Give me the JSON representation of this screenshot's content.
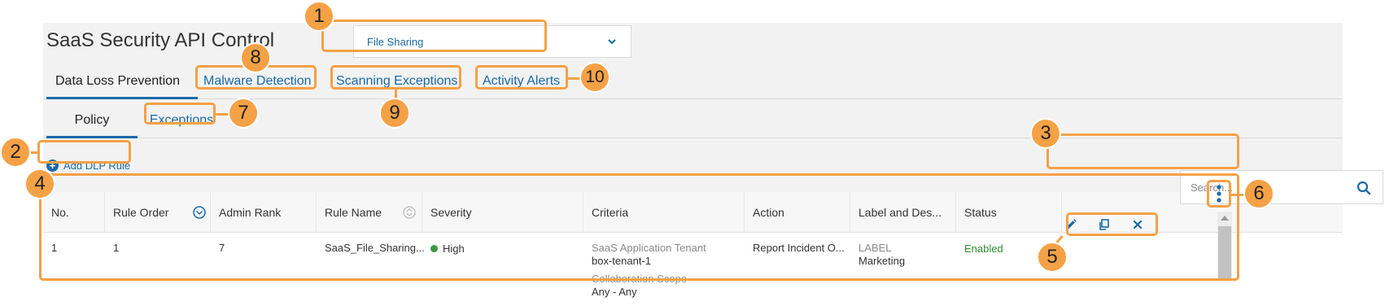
{
  "app": {
    "title": "SaaS Security API Control"
  },
  "app_selector": {
    "value": "File Sharing",
    "icon": "chevron-down-icon"
  },
  "primary_tabs": [
    {
      "label": "Data Loss Prevention",
      "active": true
    },
    {
      "label": "Malware Detection",
      "active": false
    },
    {
      "label": "Scanning Exceptions",
      "active": false
    },
    {
      "label": "Activity Alerts",
      "active": false
    }
  ],
  "secondary_tabs": [
    {
      "label": "Policy",
      "active": true
    },
    {
      "label": "Exceptions",
      "active": false
    }
  ],
  "toolbar": {
    "add_label": "Add DLP Rule",
    "add_icon": "plus-circle-icon"
  },
  "search": {
    "placeholder": "Search...",
    "icon": "search-icon"
  },
  "table": {
    "columns": [
      "No.",
      "Rule Order",
      "Admin Rank",
      "Rule Name",
      "Severity",
      "Criteria",
      "Action",
      "Label and Des...",
      "Status"
    ],
    "rows": [
      {
        "no": "1",
        "rule_order": "1",
        "admin_rank": "7",
        "rule_name": "SaaS_File_Sharing...",
        "severity": "High",
        "criteria": [
          {
            "label": "SaaS Application Tenant",
            "value": "box-tenant-1"
          },
          {
            "label": "Collaboration Scope",
            "value": "Any - Any"
          }
        ],
        "action": "Report Incident O...",
        "label_title": "LABEL",
        "label_value": "Marketing",
        "status": "Enabled"
      }
    ]
  },
  "callouts": [
    "1",
    "2",
    "3",
    "4",
    "5",
    "6",
    "7",
    "8",
    "9",
    "10"
  ],
  "colors": {
    "accent": "#f5a146",
    "link": "#1a6aa8",
    "enabled": "#2e8b2e",
    "severity_high": "#3a9a3a"
  }
}
